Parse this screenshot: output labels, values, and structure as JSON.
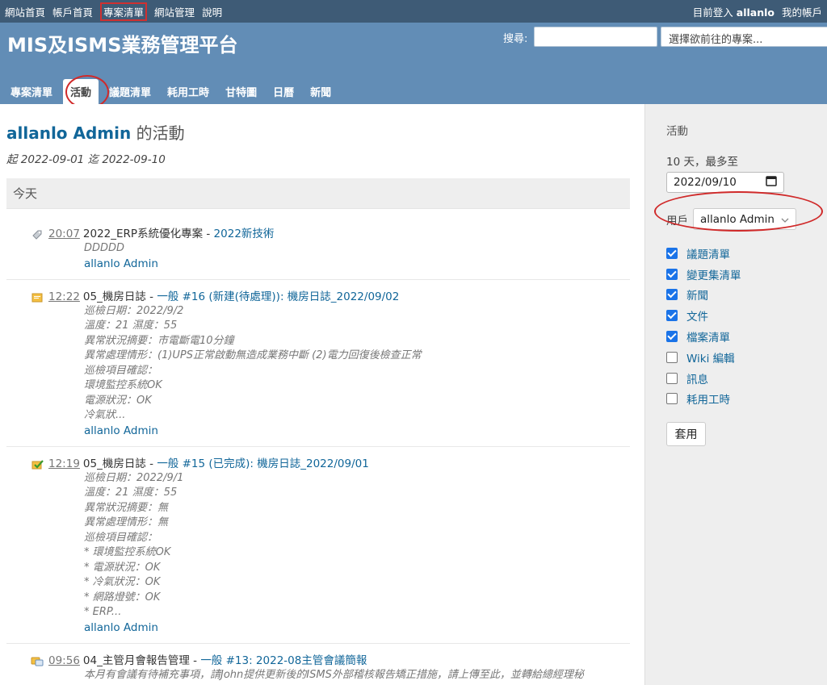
{
  "top_menu": {
    "items": [
      "網站首頁",
      "帳戶首頁",
      "專案清單",
      "網站管理",
      "說明"
    ],
    "logged_as_prefix": "目前登入",
    "logged_as_user": "allanlo",
    "account": "我的帳戶"
  },
  "header": {
    "title": "MIS及ISMS業務管理平台",
    "search_label": "搜尋:",
    "project_jump": "選擇欲前往的專案..."
  },
  "main_menu": [
    "專案清單",
    "活動",
    "議題清單",
    "耗用工時",
    "甘特圖",
    "日曆",
    "新聞"
  ],
  "content": {
    "user_link": "allanlo Admin",
    "title_suffix": " 的活動",
    "subtitle": "起 2022-09-01 迄 2022-09-10",
    "day_header": "今天",
    "events": [
      {
        "time": "20:07",
        "project": "2022_ERP系統優化專案",
        "sep": " - ",
        "link": "2022新技術",
        "desc": "DDDDD",
        "author": "allanlo Admin",
        "icon": "attachment-icon"
      },
      {
        "time": "12:22",
        "project": "05_機房日誌",
        "sep": " - ",
        "link": "一般 #16 (新建(待處理)): 機房日誌_2022/09/02",
        "desc": "巡檢日期：2022/9/2\n溫度：21 濕度：55\n異常狀況摘要：市電斷電10分鐘\n異常處理情形：(1)UPS正常啟動無造成業務中斷 (2)電力回復後檢查正常\n巡檢項目確認：\n環境監控系統OK\n電源狀況：OK\n冷氣狀...",
        "author": "allanlo Admin",
        "icon": "issue-new-icon"
      },
      {
        "time": "12:19",
        "project": "05_機房日誌",
        "sep": " - ",
        "link": "一般 #15 (已完成): 機房日誌_2022/09/01",
        "desc": "巡檢日期：2022/9/1\n溫度：21 濕度：55\n異常狀況摘要：無\n異常處理情形：無\n巡檢項目確認：\n* 環境監控系統OK\n* 電源狀況：OK\n* 冷氣狀況：OK\n* 網路燈號：OK\n* ERP...",
        "author": "allanlo Admin",
        "icon": "issue-closed-icon"
      },
      {
        "time": "09:56",
        "project": "04_主管月會報告管理",
        "sep": " - ",
        "link": "一般 #13: 2022-08主管會議簡報",
        "desc": "本月有會議有待補充事項，請John提供更新後的ISMS外部稽核報告矯正措施，請上傳至此，並轉給總經理秘",
        "author": "",
        "icon": "issue-note-icon"
      }
    ]
  },
  "sidebar": {
    "title": "活動",
    "days": "10 天，最多至",
    "date": "2022/09/10",
    "user_label": "用戶",
    "user_value": "allanlo Admin",
    "filters": [
      {
        "label": "議題清單",
        "checked": true
      },
      {
        "label": "變更集清單",
        "checked": true
      },
      {
        "label": "新聞",
        "checked": true
      },
      {
        "label": "文件",
        "checked": true
      },
      {
        "label": "檔案清單",
        "checked": true
      },
      {
        "label": "Wiki 編輯",
        "checked": false
      },
      {
        "label": "訊息",
        "checked": false
      },
      {
        "label": "耗用工時",
        "checked": false
      }
    ],
    "apply": "套用"
  }
}
